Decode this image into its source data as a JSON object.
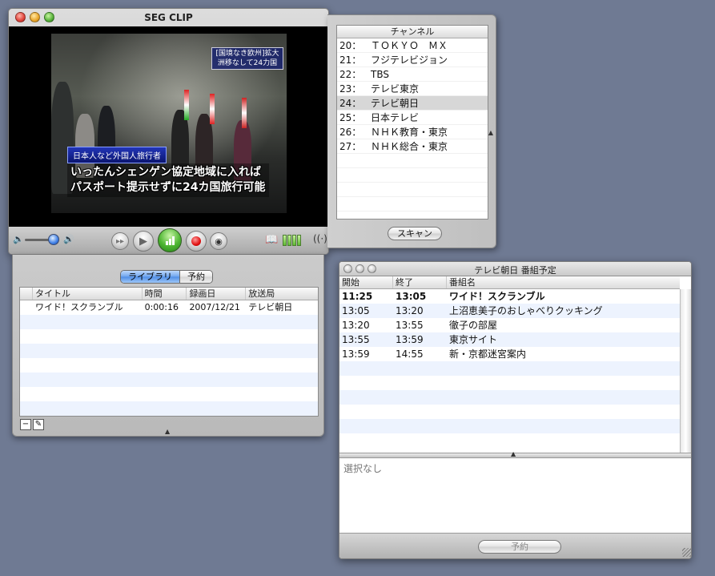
{
  "player": {
    "title": "SEG CLIP",
    "caption_top": "[国境なき欧州]拡大 洲移なして24力国",
    "caption_blue": "日本人など外国人旅行者",
    "caption_main_1": "いったんシェンゲン協定地域に入れば",
    "caption_main_2": "パスポート提示せずに24カ国旅行可能",
    "volume_level": 0.85,
    "signal_bars_lit": 4,
    "signal_bars_total": 4,
    "icons": {
      "volume_low": "speaker-low-icon",
      "volume_high": "speaker-high-icon",
      "fast_forward": "fast-forward-icon",
      "play": "play-icon",
      "live": "live-signal-icon",
      "record": "record-icon",
      "snapshot": "camera-icon",
      "guide": "book-icon",
      "antenna": "antenna-icon"
    }
  },
  "channels": {
    "header": "チャンネル",
    "items": [
      {
        "num": "20：",
        "name": "ＴＯＫＹＯ　ＭＸ"
      },
      {
        "num": "21：",
        "name": "フジテレビジョン"
      },
      {
        "num": "22：",
        "name": "TBS"
      },
      {
        "num": "23：",
        "name": "テレビ東京"
      },
      {
        "num": "24：",
        "name": "テレビ朝日"
      },
      {
        "num": "25：",
        "name": "日本テレビ"
      },
      {
        "num": "26：",
        "name": "ＮＨＫ教育・東京"
      },
      {
        "num": "27：",
        "name": "ＮＨＫ総合・東京"
      }
    ],
    "selected_index": 4,
    "scan_label": "スキャン"
  },
  "library": {
    "tabs": [
      "ライブラリ",
      "予約"
    ],
    "active_tab": 0,
    "columns": [
      "タイトル",
      "時間",
      "録画日",
      "放送局"
    ],
    "rows": [
      {
        "title": "ワイド！スクランブル",
        "duration": "0:00:16",
        "date": "2007/12/21",
        "station": "テレビ朝日"
      }
    ],
    "remove_label": "−",
    "edit_label": "✎"
  },
  "schedule": {
    "title": "テレビ朝日 番組予定",
    "columns": [
      "開始",
      "終了",
      "番組名"
    ],
    "rows": [
      {
        "start": "11:25",
        "end": "13:05",
        "name": "ワイド！スクランブル",
        "current": true
      },
      {
        "start": "13:05",
        "end": "13:20",
        "name": "上沼恵美子のおしゃべりクッキング",
        "current": false
      },
      {
        "start": "13:20",
        "end": "13:55",
        "name": "徹子の部屋",
        "current": false
      },
      {
        "start": "13:55",
        "end": "13:59",
        "name": "東京サイト",
        "current": false
      },
      {
        "start": "13:59",
        "end": "14:55",
        "name": "新・京都迷宮案内",
        "current": false
      }
    ],
    "detail_text": "選択なし",
    "reserve_label": "予約"
  }
}
